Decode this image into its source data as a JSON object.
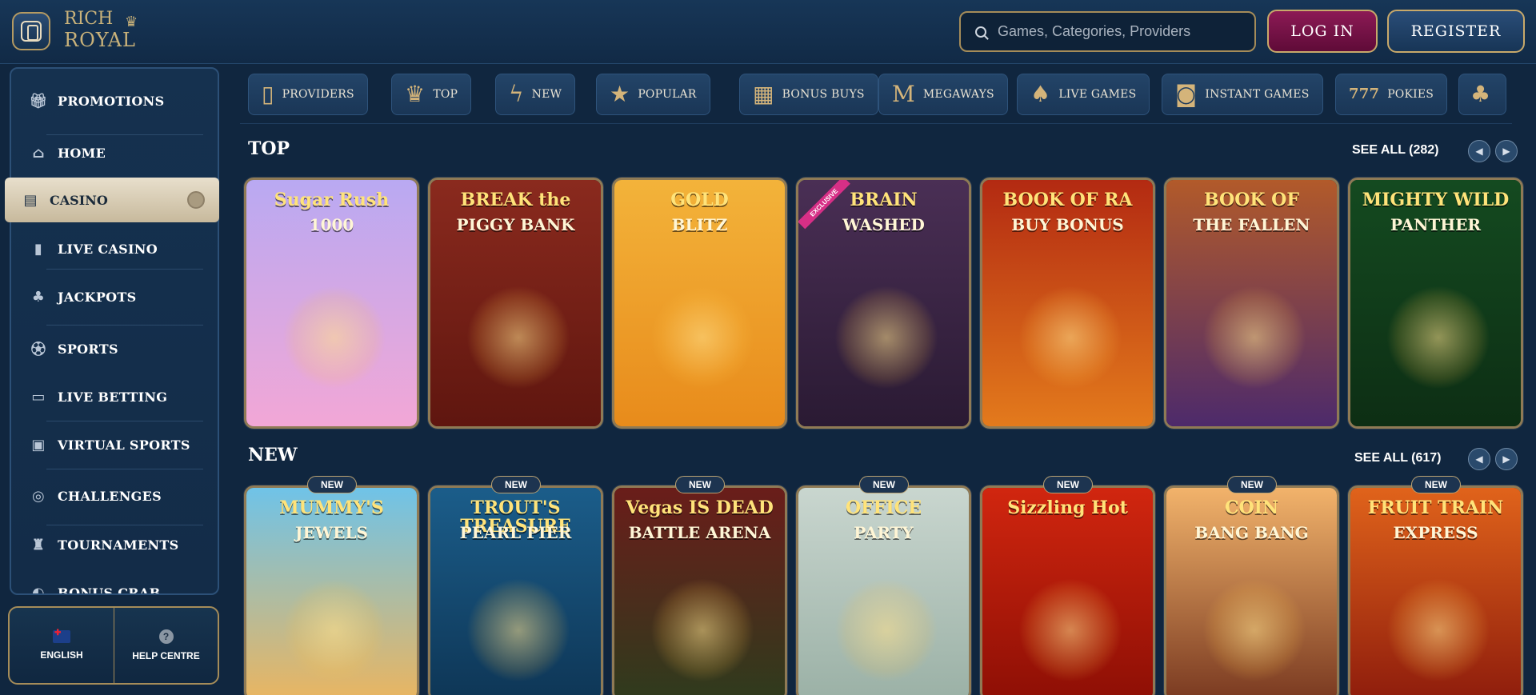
{
  "header": {
    "logo_line1": "RICH",
    "logo_line2": "ROYAL",
    "search_placeholder": "Games, Categories, Providers",
    "login_label": "LOG IN",
    "register_label": "REGISTER"
  },
  "sidebar": {
    "items": [
      {
        "label": "PROMOTIONS",
        "icon": "gift-icon"
      },
      {
        "label": "HOME",
        "icon": "bank-icon"
      },
      {
        "label": "CASINO",
        "icon": "slot-machine-icon",
        "active": true
      },
      {
        "label": "LIVE CASINO",
        "icon": "cards-icon"
      },
      {
        "label": "JACKPOTS",
        "icon": "clover-icon"
      },
      {
        "label": "SPORTS",
        "icon": "ball-icon"
      },
      {
        "label": "LIVE BETTING",
        "icon": "live-icon"
      },
      {
        "label": "VIRTUAL SPORTS",
        "icon": "monitor-icon"
      },
      {
        "label": "CHALLENGES",
        "icon": "target-icon"
      },
      {
        "label": "TOURNAMENTS",
        "icon": "trophy-icon"
      },
      {
        "label": "BONUS CRAB",
        "icon": "crab-claw-icon"
      }
    ],
    "footer": {
      "language_label": "ENGLISH",
      "help_label": "HELP CENTRE"
    }
  },
  "categories": [
    {
      "label": "PROVIDERS",
      "icon": "book-icon"
    },
    {
      "label": "TOP",
      "icon": "crown-icon"
    },
    {
      "label": "NEW",
      "icon": "lightning-icon"
    },
    {
      "label": "POPULAR",
      "icon": "star-icon"
    },
    {
      "label": "BONUS BUYS",
      "icon": "gift-box-icon"
    },
    {
      "label": "MEGAWAYS",
      "icon": "megaways-icon"
    },
    {
      "label": "LIVE GAMES",
      "icon": "playing-cards-icon"
    },
    {
      "label": "INSTANT GAMES",
      "icon": "gamepad-icon"
    },
    {
      "label": "POKIES",
      "icon": "seven-seven-seven-icon"
    },
    {
      "label": "",
      "icon": "club-icon"
    }
  ],
  "sections": {
    "top": {
      "title": "TOP",
      "see_all": "SEE ALL (282)",
      "games": [
        {
          "name_line1": "Sugar Rush",
          "name_line2": "1000",
          "colors": [
            "#b9a9f2",
            "#f2a7d6"
          ]
        },
        {
          "name_line1": "BREAK the",
          "name_line2": "PIGGY BANK",
          "colors": [
            "#8a2a1e",
            "#5f160f"
          ]
        },
        {
          "name_line1": "GOLD",
          "name_line2": "BLITZ",
          "colors": [
            "#f3b33a",
            "#e88b1b"
          ]
        },
        {
          "name_line1": "BRAIN",
          "name_line2": "WASHED",
          "colors": [
            "#4a2f55",
            "#2a1a33"
          ],
          "tag": "EXCLUSIVE"
        },
        {
          "name_line1": "BOOK OF RA",
          "name_line2": "BUY BONUS",
          "colors": [
            "#b32a12",
            "#e37a1c"
          ]
        },
        {
          "name_line1": "BOOK OF",
          "name_line2": "THE FALLEN",
          "colors": [
            "#b25a2a",
            "#4d2a6b"
          ]
        },
        {
          "name_line1": "MIGHTY WILD",
          "name_line2": "PANTHER",
          "colors": [
            "#144a20",
            "#0d2e14"
          ]
        }
      ]
    },
    "new": {
      "title": "NEW",
      "see_all": "SEE ALL (617)",
      "badge_label": "NEW",
      "games": [
        {
          "name_line1": "MUMMY'S",
          "name_line2": "JEWELS",
          "colors": [
            "#6fc3e8",
            "#e9b561"
          ]
        },
        {
          "name_line1": "TROUT'S TREASURE",
          "name_line2": "PEARL PIER",
          "colors": [
            "#1b5d8a",
            "#0e3656"
          ]
        },
        {
          "name_line1": "Vegas IS DEAD",
          "name_line2": "BATTLE ARENA",
          "colors": [
            "#6a1d1a",
            "#2f3b1d"
          ]
        },
        {
          "name_line1": "OFFICE",
          "name_line2": "PARTY",
          "colors": [
            "#c9d6cf",
            "#9bb1a6"
          ]
        },
        {
          "name_line1": "Sizzling Hot",
          "name_line2": "",
          "colors": [
            "#d1260f",
            "#8e0f05"
          ]
        },
        {
          "name_line1": "COIN",
          "name_line2": "BANG BANG",
          "colors": [
            "#f2b36b",
            "#7a3a21"
          ]
        },
        {
          "name_line1": "FRUIT TRAIN",
          "name_line2": "EXPRESS",
          "colors": [
            "#e0631b",
            "#8f1d0c"
          ]
        }
      ]
    }
  }
}
